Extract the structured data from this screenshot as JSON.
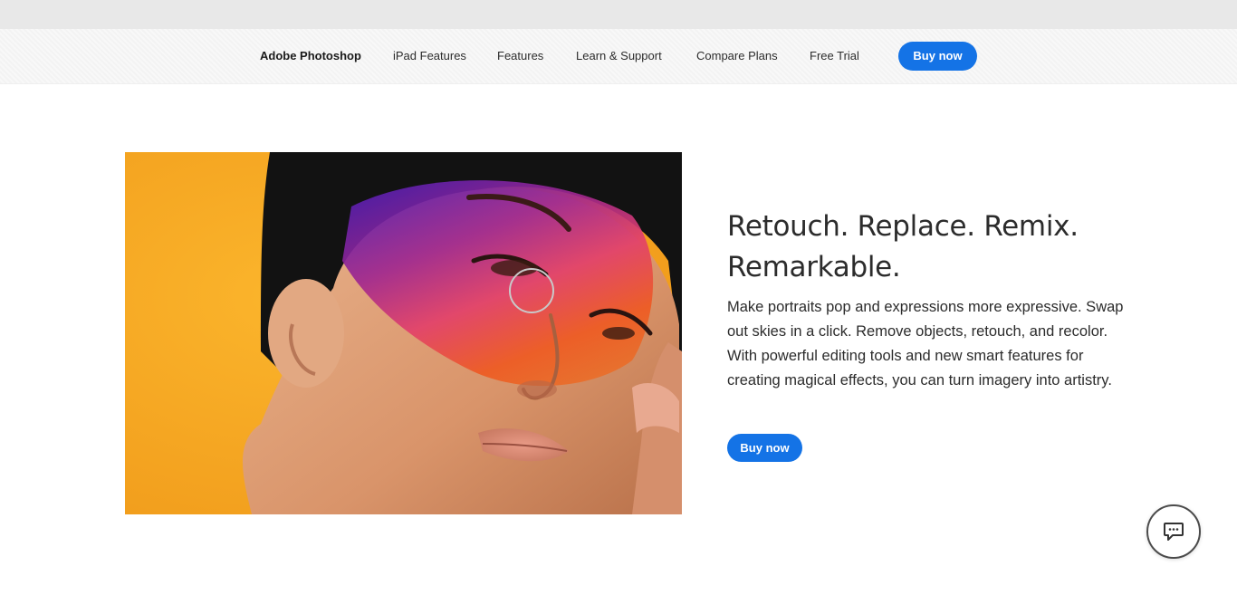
{
  "nav": {
    "brand": "Adobe Photoshop",
    "items": [
      {
        "label": "iPad Features"
      },
      {
        "label": "Features"
      },
      {
        "label": "Learn & Support"
      },
      {
        "label": "Compare Plans"
      },
      {
        "label": "Free Trial"
      }
    ],
    "buy_label": "Buy now"
  },
  "hero": {
    "title": "Retouch. Replace. Remix. Remarkable.",
    "body": "Make portraits pop and expressions more expressive. Swap out skies in a click. Remove objects, retouch, and recolor. With powerful editing tools and new smart features for creating magical effects, you can turn imagery into artistry.",
    "buy_label": "Buy now",
    "image": {
      "subject": "portrait-photo",
      "background_color": "#f9ad25"
    }
  },
  "chat": {
    "icon": "chat-bubble-icon"
  },
  "colors": {
    "accent": "#1473e6",
    "text": "#2c2c2c",
    "topbar": "#e8e8e8"
  }
}
